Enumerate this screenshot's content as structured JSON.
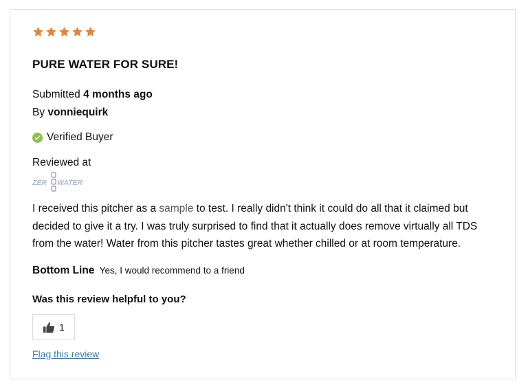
{
  "review": {
    "rating": 5,
    "rating_max": 5,
    "star_color": "#e8833a",
    "title": "PURE WATER FOR SURE!",
    "submitted_prefix": "Submitted",
    "submitted_value": "4 months ago",
    "by_prefix": "By",
    "author": "vonniequirk",
    "verified_label": "Verified Buyer",
    "verified_color": "#8bc34a",
    "reviewed_at_label": "Reviewed at",
    "retailer_logo_text_left": "ZER",
    "retailer_logo_text_right": "WATER",
    "body_part1": "I received this pitcher as a ",
    "body_highlight": "sample",
    "body_part2": " to test. I really didn't think it could do all that it claimed but decided to give it a try. I was truly surprised to find that it actually does remove virtually all TDS from the water! Water from this pitcher tastes great whether chilled or at room temperature.",
    "bottom_line_label": "Bottom Line",
    "bottom_line_value": "Yes, I would recommend to a friend",
    "helpful_question": "Was this review helpful to you?",
    "helpful_count": "1",
    "flag_label": "Flag this review",
    "link_color": "#2a7bbf"
  }
}
